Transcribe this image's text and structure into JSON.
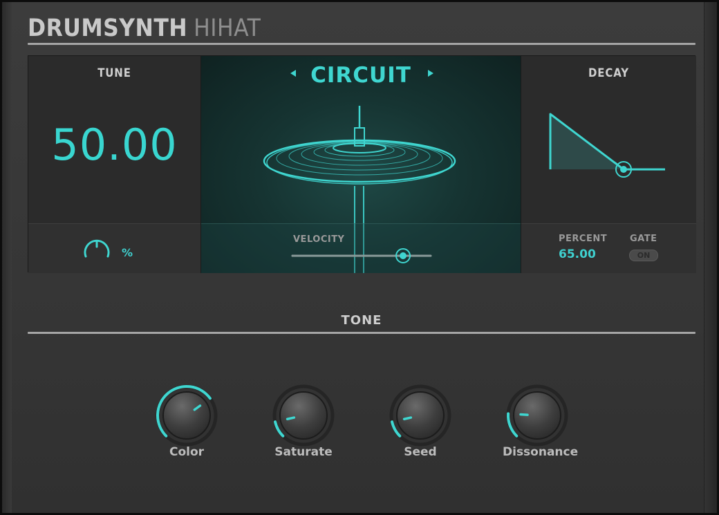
{
  "header": {
    "brand": "DRUMSYNTH",
    "model": "HIHAT"
  },
  "tune": {
    "label": "TUNE",
    "value": "50.00",
    "unit": "%"
  },
  "engine": {
    "name": "CIRCUIT",
    "prev_icon": "triangle-left-icon",
    "next_icon": "triangle-right-icon",
    "image_icon": "cymbal-icon"
  },
  "velocity": {
    "label": "VELOCITY",
    "level": 0.8
  },
  "decay": {
    "label": "DECAY",
    "percent_label": "PERCENT",
    "percent_value": "65.00",
    "gate_label": "GATE",
    "gate_value": "ON",
    "envelope_level": 0.65
  },
  "tone": {
    "label": "TONE",
    "knobs": [
      {
        "name": "Color",
        "value": 0.7
      },
      {
        "name": "Saturate",
        "value": 0.12
      },
      {
        "name": "Seed",
        "value": 0.12
      },
      {
        "name": "Dissonance",
        "value": 0.18
      }
    ]
  },
  "colors": {
    "accent": "#3fd6d0",
    "panel": "#2b2b2b",
    "background": "#383838"
  }
}
